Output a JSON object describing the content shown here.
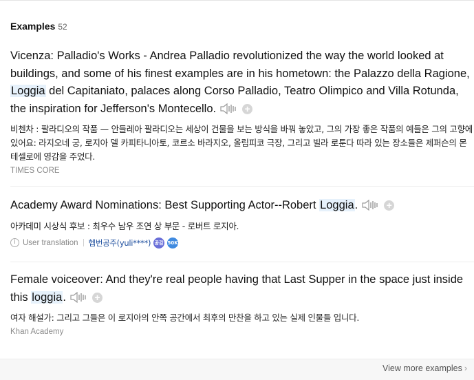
{
  "header": {
    "title": "Examples",
    "count": "52"
  },
  "examples": [
    {
      "en_before": "Vicenza: Palladio's Works - Andrea Palladio revolutionized the way the world looked at buildings, and some of his finest examples are in his hometown: the Palazzo della Ragione, ",
      "keyword": "Loggia",
      "en_after": " del Capitaniato, palaces along Corso Palladio, Teatro Olimpico and Villa Rotunda, the inspiration for Jefferson's Montecello.",
      "ko": "비첸차 : 팔라디오의 작품 — 안들레아 팔라디오는 세상이 건물을 보는 방식을 바꿔 놓았고, 그의 가장 좋은 작품의 예들은 그의 고향에 있어요: 라지오네 궁, 로지아 델 카피타니아토, 코르소 바라지오, 올림피코 극장, 그리고 빌라 로툰다 따라 있는 장소들은 제퍼슨의 몬테셀로에 영감을 주었다.",
      "source": "TIMES CORE"
    },
    {
      "en_before": "Academy Award Nominations: Best Supporting Actor--Robert ",
      "keyword": "Loggia",
      "en_after": ".",
      "ko": "아카데미 시상식 후보 : 최우수 남우 조연 상 부문 - 로버트 로지아.",
      "meta_label": "User translation",
      "user": "헵번공주(yuli****)",
      "badge1": "공감",
      "badge2": "50K"
    },
    {
      "en_before": "Female voiceover: And they're real people having that Last Supper in the space just inside this ",
      "keyword": "loggia",
      "en_after": ".",
      "ko": "여자 해설가: 그리고 그들은 이 로지아의 안쪽 공간에서 최후의 만찬을 하고 있는 실제 인물들 입니다.",
      "source": "Khan Academy"
    }
  ],
  "footer": {
    "more_label": "View more examples"
  },
  "icons": {
    "speaker": "speaker-icon",
    "add": "plus-circle-icon",
    "info": "info-icon",
    "chevron": "chevron-right-icon"
  }
}
